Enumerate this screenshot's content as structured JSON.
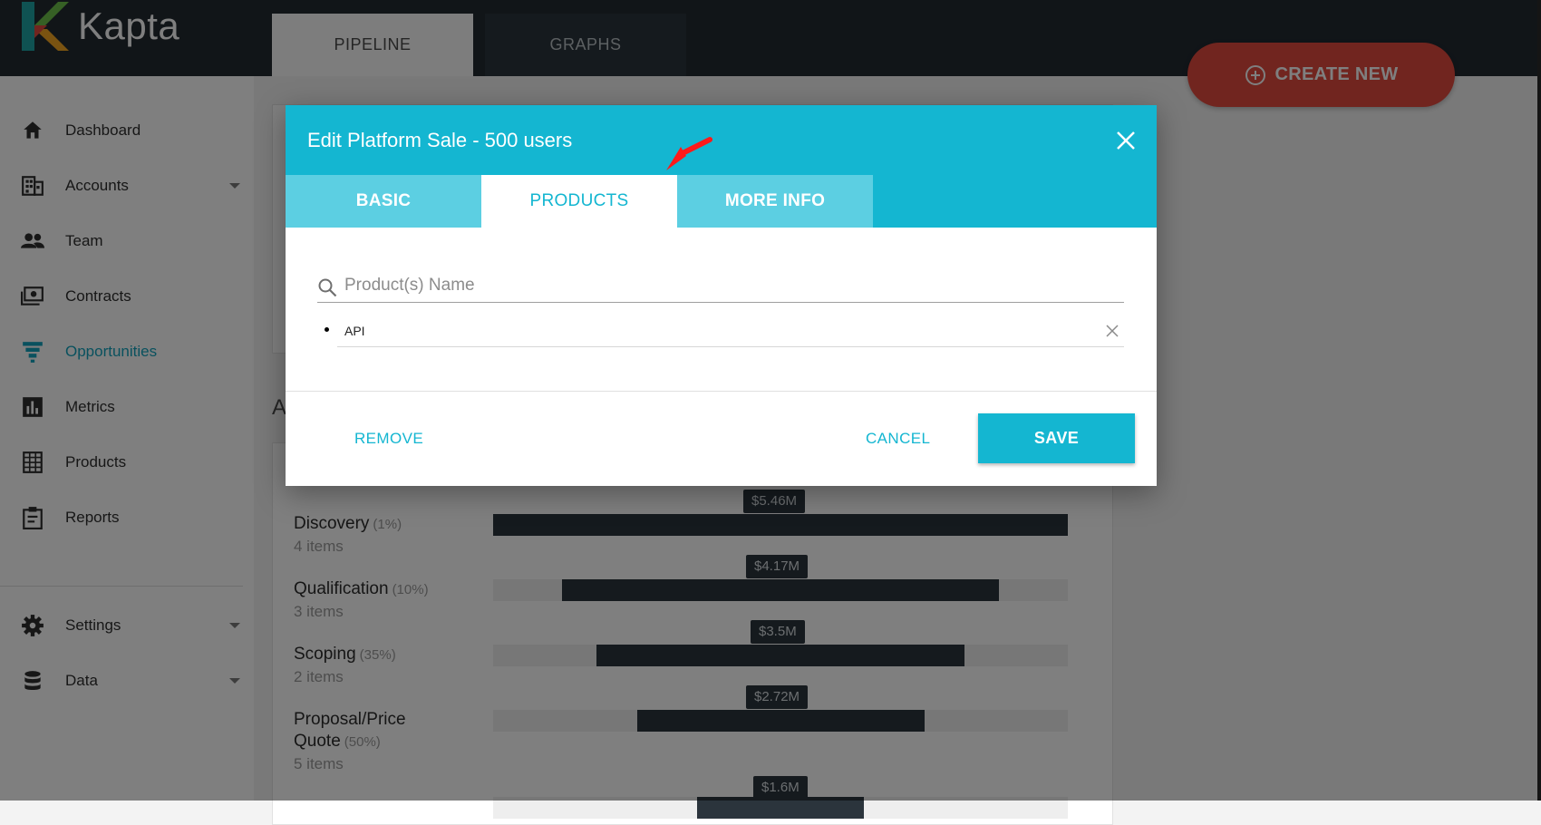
{
  "app": {
    "name": "Kapta"
  },
  "top_tabs": [
    {
      "label": "PIPELINE",
      "active": true
    },
    {
      "label": "GRAPHS",
      "active": false
    }
  ],
  "create_button": {
    "label": "CREATE NEW",
    "icon": "plus-circle-icon"
  },
  "sidebar": {
    "items": [
      {
        "label": "Dashboard",
        "icon": "home-icon"
      },
      {
        "label": "Accounts",
        "icon": "building-icon",
        "has_dropdown": true
      },
      {
        "label": "Team",
        "icon": "people-icon"
      },
      {
        "label": "Contracts",
        "icon": "money-icon"
      },
      {
        "label": "Opportunities",
        "icon": "funnel-icon",
        "active": true
      },
      {
        "label": "Metrics",
        "icon": "bar-chart-icon"
      },
      {
        "label": "Products",
        "icon": "grid-icon"
      },
      {
        "label": "Reports",
        "icon": "clipboard-icon"
      },
      {
        "label": "Settings",
        "icon": "gear-icon",
        "has_dropdown": true
      },
      {
        "label": "Data",
        "icon": "database-icon",
        "has_dropdown": true
      }
    ]
  },
  "background": {
    "section_letter": "A",
    "stages": [
      {
        "name": "Discovery",
        "pct": "(1%)",
        "items": "4 items",
        "amount": "$5.46M",
        "fill": 1.0
      },
      {
        "name": "Qualification",
        "pct": "(10%)",
        "items": "3 items",
        "amount": "$4.17M",
        "fill": 0.76
      },
      {
        "name": "Scoping",
        "pct": "(35%)",
        "items": "2 items",
        "amount": "$3.5M",
        "fill": 0.64
      },
      {
        "name_line1": "Proposal/Price",
        "name_line2": "Quote",
        "pct": "(50%)",
        "items": "5 items",
        "amount": "$2.72M",
        "fill": 0.5
      },
      {
        "amount": "$1.6M",
        "fill": 0.29
      }
    ]
  },
  "modal": {
    "title": "Edit Platform Sale - 500 users",
    "tabs": [
      {
        "label": "BASIC",
        "active": false
      },
      {
        "label": "PRODUCTS",
        "active": true
      },
      {
        "label": "MORE INFO",
        "active": false
      }
    ],
    "search": {
      "placeholder": "Product(s) Name",
      "value": ""
    },
    "products": [
      "API"
    ],
    "buttons": {
      "remove": "REMOVE",
      "cancel": "CANCEL",
      "save": "SAVE"
    }
  },
  "colors": {
    "accent": "#14b6d1",
    "tab_inactive": "#5ccfe2",
    "create_button": "#e24a3f",
    "topbar": "#222a31",
    "annotation_arrow": "#ff1a1a"
  }
}
